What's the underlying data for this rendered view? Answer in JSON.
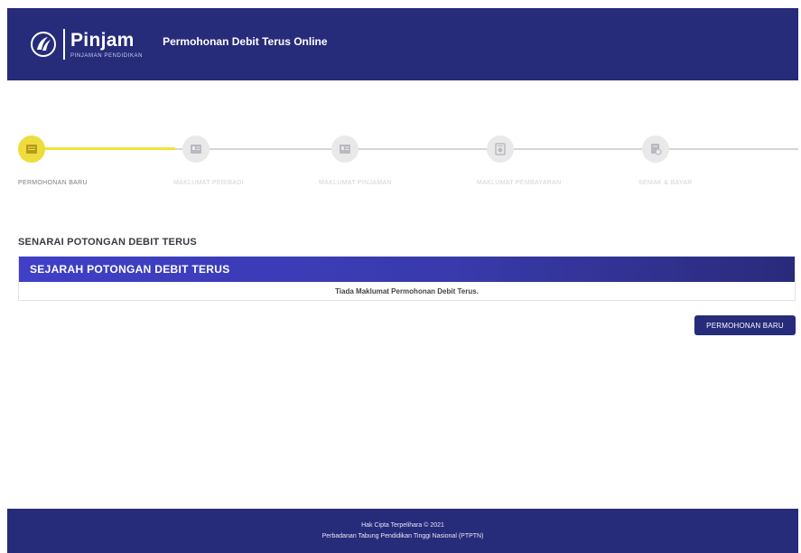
{
  "header": {
    "logo_title": "Pinjam",
    "logo_subtitle": "PINJAMAN PENDIDIKAN",
    "page_title": "Permohonan Debit Terus Online"
  },
  "stepper": {
    "steps": [
      {
        "label": "PERMOHONAN BARU",
        "icon": "document-icon",
        "active": true
      },
      {
        "label": "MAKLUMAT PERIBADI",
        "icon": "id-card-icon",
        "active": false
      },
      {
        "label": "MAKLUMAT PINJAMAN",
        "icon": "id-card-icon",
        "active": false
      },
      {
        "label": "MAKLUMAT PEMBAYARAN",
        "icon": "payment-icon",
        "active": false
      },
      {
        "label": "SEMAK & BAYAR",
        "icon": "review-icon",
        "active": false
      }
    ]
  },
  "section": {
    "title": "SENARAI POTONGAN DEBIT TERUS",
    "panel_title": "SEJARAH POTONGAN DEBIT TERUS",
    "empty_message": "Tiada Maklumat Permohonan Debit Terus."
  },
  "actions": {
    "new_application_label": "PERMOHONAN BARU"
  },
  "footer": {
    "copyright": "Hak Cipta Terpelihara © 2021",
    "organization": "Perbadanan Tabung Pendidikan Tinggi Nasional (PTPTN)"
  },
  "colors": {
    "brand": "#262b7a",
    "step_active": "#eddc3c",
    "step_inactive": "#e9e9ea"
  }
}
